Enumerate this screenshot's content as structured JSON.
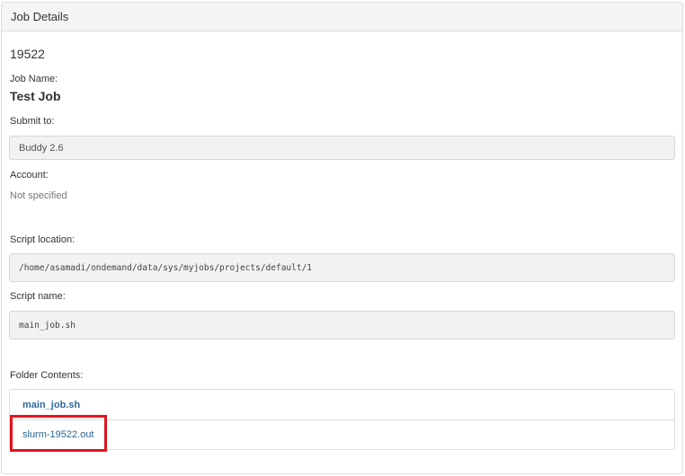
{
  "panel": {
    "title": "Job Details"
  },
  "job": {
    "id": "19522",
    "name_label": "Job Name:",
    "name": "Test Job",
    "submit_label": "Submit to:",
    "submit_value": "Buddy 2.6",
    "account_label": "Account:",
    "account_value": "Not specified",
    "script_location_label": "Script location:",
    "script_location_value": "/home/asamadi/ondemand/data/sys/myjobs/projects/default/1",
    "script_name_label": "Script name:",
    "script_name_value": "main_job.sh",
    "folder_contents_label": "Folder Contents:"
  },
  "folder_contents": [
    {
      "label": "main_job.sh"
    },
    {
      "label": "slurm-19522.out"
    }
  ],
  "colors": {
    "link": "#2a6496",
    "highlight": "#e0141e",
    "well_bg": "#f2f2f2"
  }
}
